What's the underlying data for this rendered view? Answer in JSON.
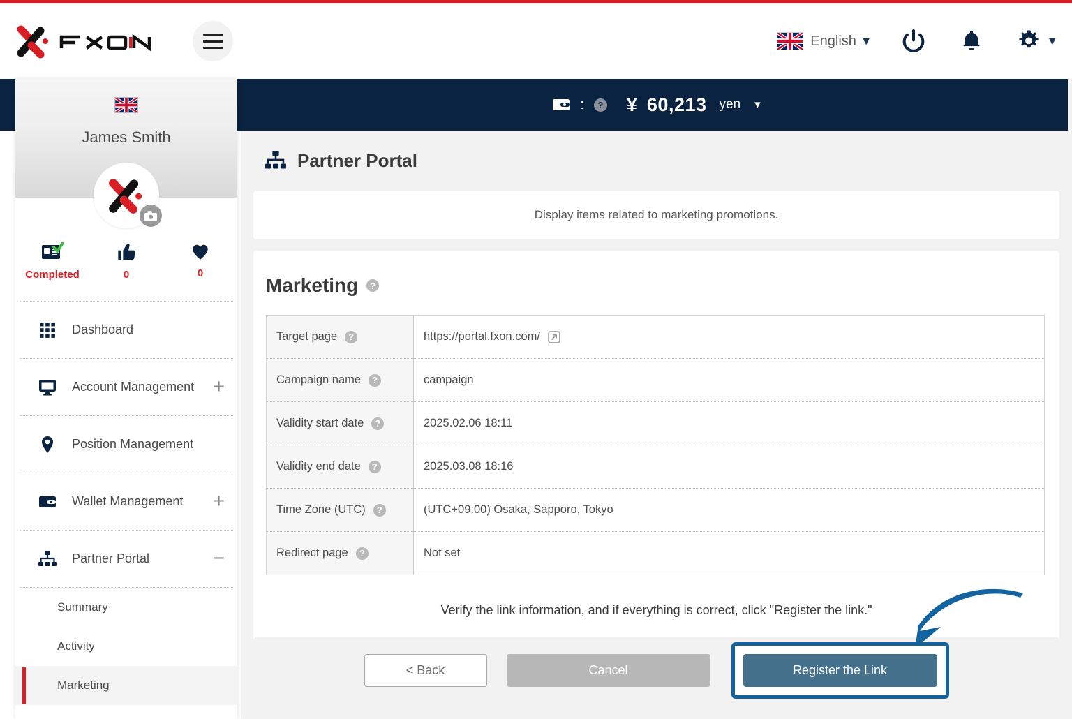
{
  "header": {
    "brand": "FXON",
    "menu_icon": "hamburger-icon",
    "language": "English",
    "language_flag": "uk-flag",
    "power_icon": "power-icon",
    "bell_icon": "bell-icon",
    "gear_icon": "gear-icon"
  },
  "balance_bar": {
    "wallet_icon": "wallet-icon",
    "separator": ":",
    "help": "?",
    "currency_symbol": "¥",
    "amount": "60,213",
    "currency_label": "yen",
    "chevron": "⌄"
  },
  "sidebar": {
    "flag": "uk-flag",
    "user_name": "James Smith",
    "avatar_camera_icon": "camera-icon",
    "stats": [
      {
        "icon": "id-card-verified-icon",
        "label": "Completed"
      },
      {
        "icon": "thumbs-up-icon",
        "label": "0"
      },
      {
        "icon": "heart-icon",
        "label": "0"
      }
    ],
    "items": [
      {
        "label": "Dashboard",
        "icon": "grid-icon",
        "expander": ""
      },
      {
        "label": "Account Management",
        "icon": "monitor-icon",
        "expander": "+"
      },
      {
        "label": "Position Management",
        "icon": "map-pin-icon",
        "expander": ""
      },
      {
        "label": "Wallet Management",
        "icon": "wallet-icon",
        "expander": "+"
      },
      {
        "label": "Partner Portal",
        "icon": "sitemap-icon",
        "expander": "−"
      }
    ],
    "sub_items": [
      {
        "label": "Summary",
        "active": false
      },
      {
        "label": "Activity",
        "active": false
      },
      {
        "label": "Marketing",
        "active": true
      }
    ]
  },
  "main": {
    "page_icon": "sitemap-icon",
    "page_title": "Partner Portal",
    "description": "Display items related to marketing promotions.",
    "section_title": "Marketing",
    "section_help": "?",
    "table": {
      "rows": [
        {
          "key": "Target page",
          "help": "?",
          "value": "https://portal.fxon.com/",
          "external_link_icon": "external-link-icon"
        },
        {
          "key": "Campaign name",
          "help": "?",
          "value": "campaign"
        },
        {
          "key": "Validity start date",
          "help": "?",
          "value": "2025.02.06 18:11"
        },
        {
          "key": "Validity end date",
          "help": "?",
          "value": "2025.03.08 18:16"
        },
        {
          "key": "Time Zone (UTC)",
          "help": "?",
          "value": "(UTC+09:00) Osaka, Sapporo, Tokyo"
        },
        {
          "key": "Redirect page",
          "help": "?",
          "value": "Not set"
        }
      ]
    },
    "verify_note": "Verify the link information, and if everything is correct, click \"Register the link.\"",
    "buttons": {
      "back": "< Back",
      "cancel": "Cancel",
      "register": "Register the Link"
    }
  },
  "annotation": {
    "arrow_icon": "curved-arrow-icon",
    "highlight_color": "#1263a0"
  },
  "colors": {
    "brand_red": "#d81f26",
    "navy": "#0a2340",
    "register_button": "#44708c",
    "cancel_button": "#b7b7b7",
    "annotation_blue": "#1263a0"
  }
}
